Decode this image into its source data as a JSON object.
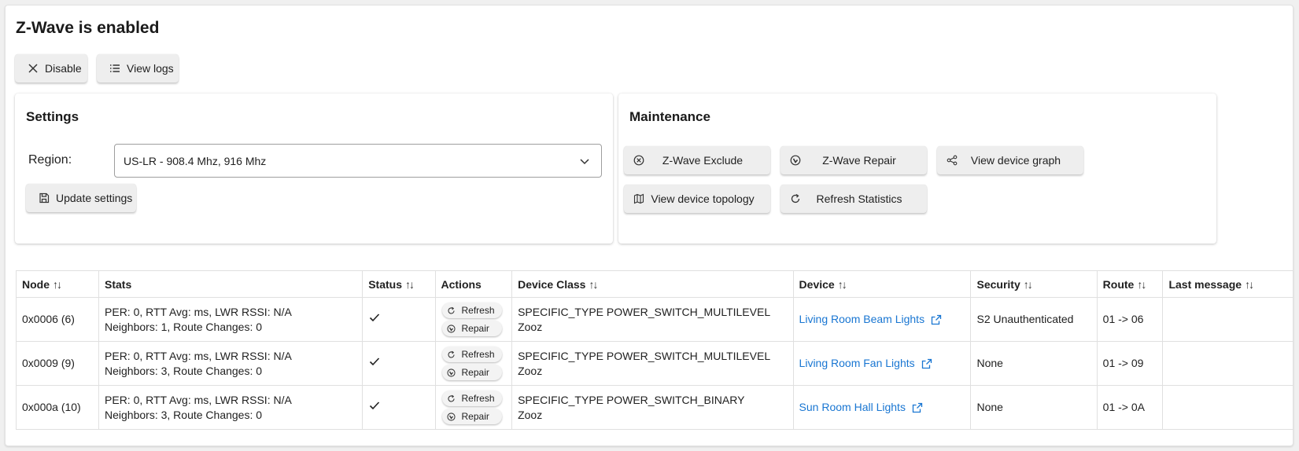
{
  "page": {
    "title": "Z-Wave is enabled"
  },
  "top_actions": {
    "disable_label": "Disable",
    "view_logs_label": "View logs"
  },
  "settings": {
    "title": "Settings",
    "region_label": "Region:",
    "region_value": "US-LR - 908.4 Mhz, 916 Mhz",
    "update_label": "Update settings"
  },
  "maintenance": {
    "title": "Maintenance",
    "exclude_label": "Z-Wave Exclude",
    "repair_label": "Z-Wave Repair",
    "graph_label": "View device graph",
    "topology_label": "View device topology",
    "refresh_stats_label": "Refresh Statistics"
  },
  "table": {
    "headers": {
      "node": "Node",
      "stats": "Stats",
      "status": "Status",
      "actions": "Actions",
      "device_class": "Device Class",
      "device": "Device",
      "security": "Security",
      "route": "Route",
      "last_message": "Last message"
    },
    "sort_glyph": "↑↓",
    "action_labels": {
      "refresh": "Refresh",
      "repair": "Repair"
    },
    "rows": [
      {
        "node": "0x0006 (6)",
        "stats_line1": "PER: 0, RTT Avg: ms, LWR RSSI: N/A",
        "stats_line2": "Neighbors: 1, Route Changes: 0",
        "status": "ok",
        "device_class_line1": "SPECIFIC_TYPE POWER_SWITCH_MULTILEVEL",
        "device_class_line2": "Zooz",
        "device": "Living Room Beam Lights",
        "security": "S2 Unauthenticated",
        "route": "01 -> 06",
        "last_message": ""
      },
      {
        "node": "0x0009 (9)",
        "stats_line1": "PER: 0, RTT Avg: ms, LWR RSSI: N/A",
        "stats_line2": "Neighbors: 3, Route Changes: 0",
        "status": "ok",
        "device_class_line1": "SPECIFIC_TYPE POWER_SWITCH_MULTILEVEL",
        "device_class_line2": "Zooz",
        "device": "Living Room Fan Lights",
        "security": "None",
        "route": "01 -> 09",
        "last_message": ""
      },
      {
        "node": "0x000a (10)",
        "stats_line1": "PER: 0, RTT Avg: ms, LWR RSSI: N/A",
        "stats_line2": "Neighbors: 3, Route Changes: 0",
        "status": "ok",
        "device_class_line1": "SPECIFIC_TYPE POWER_SWITCH_BINARY",
        "device_class_line2": "Zooz",
        "device": "Sun Room Hall Lights",
        "security": "None",
        "route": "01 -> 0A",
        "last_message": ""
      }
    ]
  },
  "colors": {
    "link": "#1976d2",
    "button_bg": "#eeeeee"
  }
}
